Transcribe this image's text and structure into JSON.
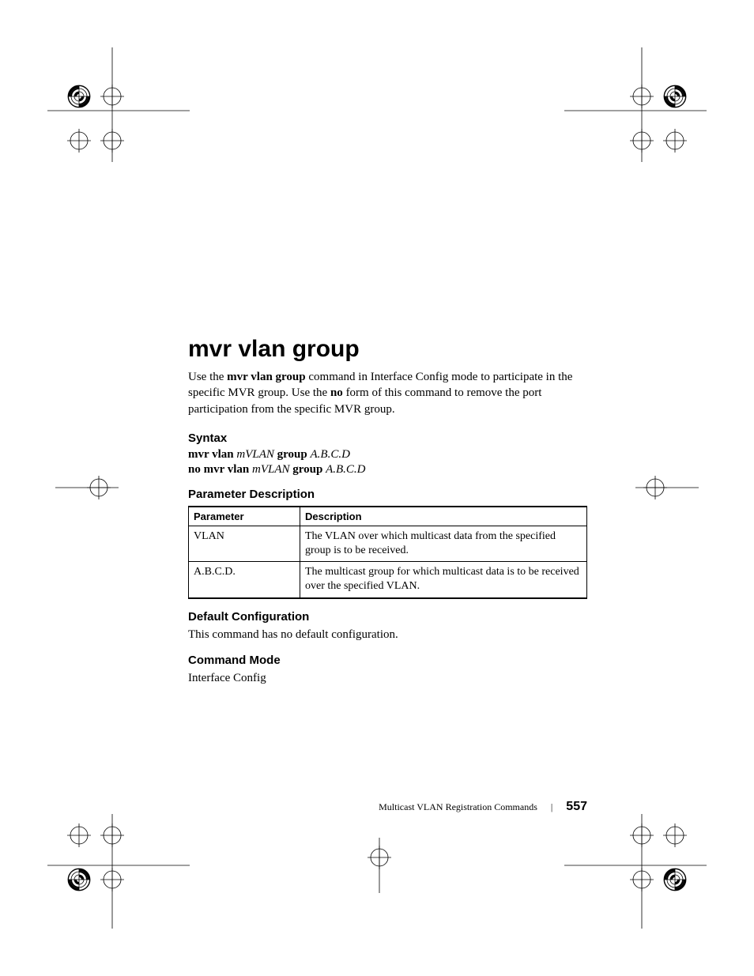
{
  "title": "mvr vlan group",
  "intro_parts": {
    "p1": "Use the ",
    "b1": "mvr vlan group",
    "p2": " command in Interface Config mode to participate in the specific MVR group. Use the ",
    "b2": "no",
    "p3": " form of this command to remove the port participation from the specific MVR group."
  },
  "sections": {
    "syntax": "Syntax",
    "param_desc": "Parameter Description",
    "default_cfg": "Default Configuration",
    "cmd_mode": "Command Mode"
  },
  "syntax": {
    "l1_b1": "mvr vlan ",
    "l1_i1": "mVLAN ",
    "l1_b2": "group ",
    "l1_i2": "A.B.C.D",
    "l2_b1": "no mvr vlan ",
    "l2_i1": "mVLAN ",
    "l2_b2": "group ",
    "l2_i2": "A.B.C.D"
  },
  "table": {
    "h1": "Parameter",
    "h2": "Description",
    "rows": [
      {
        "p": "VLAN",
        "d": "The VLAN over which multicast data from the specified group is to be received."
      },
      {
        "p": "A.B.C.D.",
        "d": "The multicast group for which multicast data is to be received over the specified VLAN."
      }
    ]
  },
  "default_cfg_text": "This command has no default configuration.",
  "cmd_mode_text": "Interface Config",
  "footer": {
    "section": "Multicast VLAN Registration Commands",
    "page": "557"
  }
}
